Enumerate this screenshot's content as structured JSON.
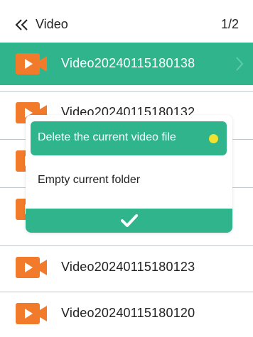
{
  "header": {
    "back_icon": "double-chevron-left-icon",
    "title": "Video",
    "page_indicator": "1/2"
  },
  "list": {
    "items": [
      {
        "label": "Video20240115180138",
        "selected": true
      },
      {
        "label": "Video20240115180132",
        "selected": false
      },
      {
        "label": "",
        "selected": false
      },
      {
        "label": "",
        "selected": false
      },
      {
        "label": "Video20240115180123",
        "selected": false
      },
      {
        "label": "Video20240115180120",
        "selected": false
      }
    ]
  },
  "dialog": {
    "options": [
      {
        "label": "Delete the current video file",
        "active": true
      },
      {
        "label": "Empty current folder",
        "active": false
      }
    ],
    "confirm_icon": "checkmark-icon"
  },
  "colors": {
    "accent": "#2fb48b",
    "video_icon": "#f27a2b",
    "indicator_dot": "#f0e22e"
  }
}
